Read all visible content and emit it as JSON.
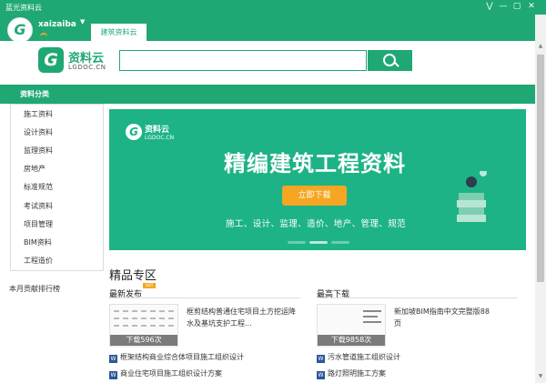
{
  "window": {
    "title": "蓝光资料云",
    "controls": [
      "⋁",
      "—",
      "▢",
      "✕"
    ]
  },
  "user": {
    "name": "xaizaiba"
  },
  "tabs": [
    {
      "label": "建筑资料云",
      "active": true
    }
  ],
  "logo": {
    "name": "资料云",
    "url": "LGDOC.CN"
  },
  "search": {
    "placeholder": "",
    "value": ""
  },
  "categories": {
    "label": "资料分类",
    "items": [
      "施工资料",
      "设计资料",
      "监理资料",
      "房地产",
      "标准规范",
      "考试资料",
      "项目管理",
      "BIM资料",
      "工程造价"
    ]
  },
  "ranking": {
    "title": "本月贡献排行榜"
  },
  "banner": {
    "brand": "资料云",
    "url": "LGDOC.CN",
    "headline": "精编建筑工程资料",
    "button": "立即下载",
    "subtitle": "施工、设计、监理、造价、地产、管理、规范",
    "slide_count": 3,
    "active_slide": 2
  },
  "section": {
    "title": "精品专区",
    "latest": {
      "label": "最新发布",
      "badge": "HOT",
      "featured": {
        "title": "框剪结构普通住宅项目土方挖运降水及基坑支护工程...",
        "downloads": "下载596次"
      },
      "list": [
        "框架结构商业综合体项目施工组织设计",
        "商业住宅项目施工组织设计方案"
      ]
    },
    "top": {
      "label": "最高下载",
      "featured": {
        "title": "新加坡BIM指南中文完整版88页",
        "downloads": "下载9858次"
      },
      "list": [
        "污水管道施工组织设计",
        "路灯照明施工方案"
      ]
    }
  },
  "colors": {
    "primary": "#1fa874",
    "banner": "#1db386",
    "button": "#f5a623",
    "word_icon": "#2b5797"
  }
}
